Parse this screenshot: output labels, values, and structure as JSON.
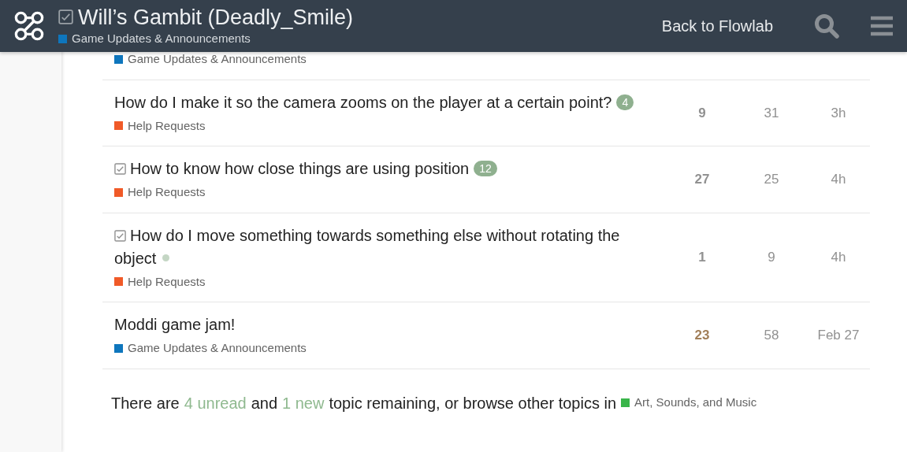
{
  "header": {
    "solved": true,
    "title": "Will’s Gambit (Deadly_Smile)",
    "category": {
      "name": "Game Updates & Announcements",
      "color": "#0e76bd"
    },
    "back_link": "Back to Flowlab"
  },
  "topics": [
    {
      "category": {
        "name": "Game Updates & Announcements",
        "color": "#0e76bd"
      }
    },
    {
      "title": "How do I make it so the camera zooms on the player at a certain point?",
      "solved": false,
      "badge": {
        "kind": "count",
        "text": "4"
      },
      "category": {
        "name": "Help Requests",
        "color": "#f05a28"
      },
      "replies": "9",
      "hot": false,
      "views": "31",
      "activity": "3h"
    },
    {
      "title": "How to know how close things are using position",
      "solved": true,
      "badge": {
        "kind": "count",
        "text": "12"
      },
      "category": {
        "name": "Help Requests",
        "color": "#f05a28"
      },
      "replies": "27",
      "hot": false,
      "views": "25",
      "activity": "4h"
    },
    {
      "title": "How do I move something towards something else without rotating the object",
      "solved": true,
      "badge": {
        "kind": "dot"
      },
      "category": {
        "name": "Help Requests",
        "color": "#f05a28"
      },
      "replies": "1",
      "hot": false,
      "views": "9",
      "activity": "4h"
    },
    {
      "title": "Moddi game jam!",
      "solved": false,
      "category": {
        "name": "Game Updates & Announcements",
        "color": "#0e76bd"
      },
      "replies": "23",
      "hot": true,
      "views": "58",
      "activity": "Feb 27"
    }
  ],
  "footer": {
    "before": "There are",
    "unread_link": "4 unread",
    "middle": "and",
    "new_link": "1 new",
    "after": "topic remaining, or browse other topics in",
    "category": {
      "name": "Art, Sounds, and Music",
      "color": "#3ab54a"
    }
  }
}
